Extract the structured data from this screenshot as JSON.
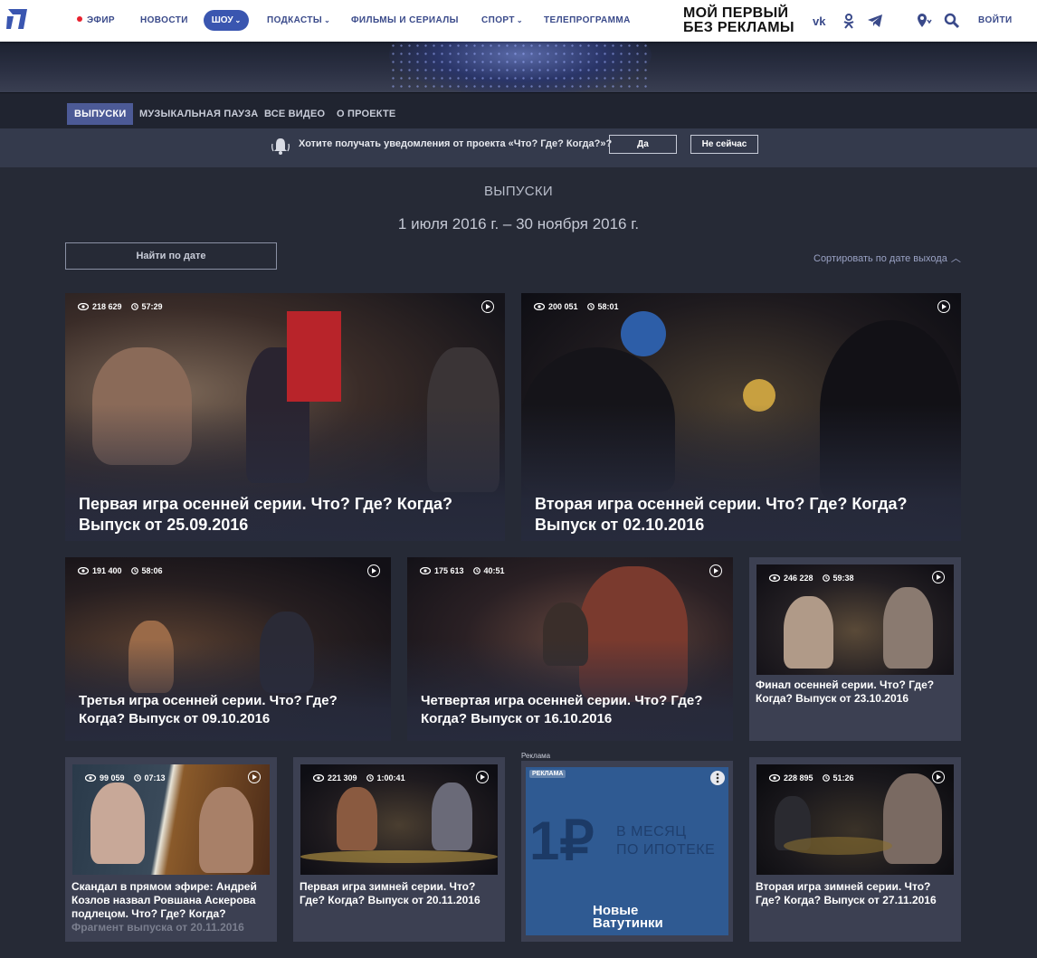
{
  "nav": {
    "live": "ЭФИР",
    "news": "НОВОСТИ",
    "shows": "ШОУ",
    "podcasts": "ПОДКАСТЫ",
    "films": "ФИЛЬМЫ И СЕРИАЛЫ",
    "sport": "СПОРТ",
    "tv": "ТЕЛЕПРОГРАММА",
    "promo_line1": "МОЙ ПЕРВЫЙ",
    "promo_line2": "БЕЗ РЕКЛАМЫ",
    "login": "ВОЙТИ"
  },
  "subnav": [
    "ВЫПУСКИ",
    "МУЗЫКАЛЬНАЯ ПАУЗА",
    "ВСЕ ВИДЕО",
    "О ПРОЕКТЕ"
  ],
  "notify": {
    "text": "Хотите получать уведомления от проекта «Что? Где? Когда?»?",
    "yes": "Да",
    "no": "Не сейчас"
  },
  "page": {
    "title": "ВЫПУСКИ",
    "date_range": "1 июля 2016 г. – 30 ноября 2016 г.",
    "date_button": "Найти по дате",
    "sort": "Сортировать по дате выхода"
  },
  "cards": [
    {
      "views": "218 629",
      "duration": "57:29",
      "title": "Первая игра осенней серии. Что? Где? Когда? Выпуск от 25.09.2016"
    },
    {
      "views": "200 051",
      "duration": "58:01",
      "title": "Вторая игра осенней серии. Что? Где? Когда? Выпуск от 02.10.2016"
    },
    {
      "views": "191 400",
      "duration": "58:06",
      "title": "Третья игра осенней серии. Что? Где? Когда? Выпуск от 09.10.2016"
    },
    {
      "views": "175 613",
      "duration": "40:51",
      "title": "Четвертая игра осенней серии. Что? Где? Когда? Выпуск от 16.10.2016"
    },
    {
      "views": "246 228",
      "duration": "59:38",
      "title": "Финал осенней серии. Что? Где? Когда? Выпуск от 23.10.2016"
    },
    {
      "views": "99 059",
      "duration": "07:13",
      "title": "Скандал в прямом эфире: Андрей Козлов назвал Ровшана Аскерова подлецом. Что? Где? Когда?",
      "title_fade": "Фрагмент выпуска от 20.11.2016"
    },
    {
      "views": "221 309",
      "duration": "1:00:41",
      "title": "Первая игра зимней серии. Что? Где? Когда? Выпуск от 20.11.2016"
    },
    {
      "views": "228 895",
      "duration": "51:26",
      "title": "Вторая игра зимней серии. Что? Где? Когда? Выпуск от 27.11.2016"
    }
  ],
  "ad": {
    "label": "Реклама",
    "badge": "РЕКЛАМА",
    "big": "1₽",
    "line1": "В МЕСЯЦ",
    "line2": "ПО ИПОТЕКЕ",
    "brand1": "Новые",
    "brand2": "Ватутинки"
  },
  "colors": {
    "page_bg": "#262a36",
    "accent": "#3a56b0",
    "live_dot": "#e8212e",
    "card_bg": "#3c4052"
  },
  "icons": [
    "channel-one-logo",
    "vk-icon",
    "odnoklassniki-icon",
    "telegram-icon",
    "location-icon",
    "search-icon",
    "bell-icon",
    "eye-icon",
    "clock-icon",
    "play-icon",
    "chevron-up-icon",
    "more-icon"
  ]
}
